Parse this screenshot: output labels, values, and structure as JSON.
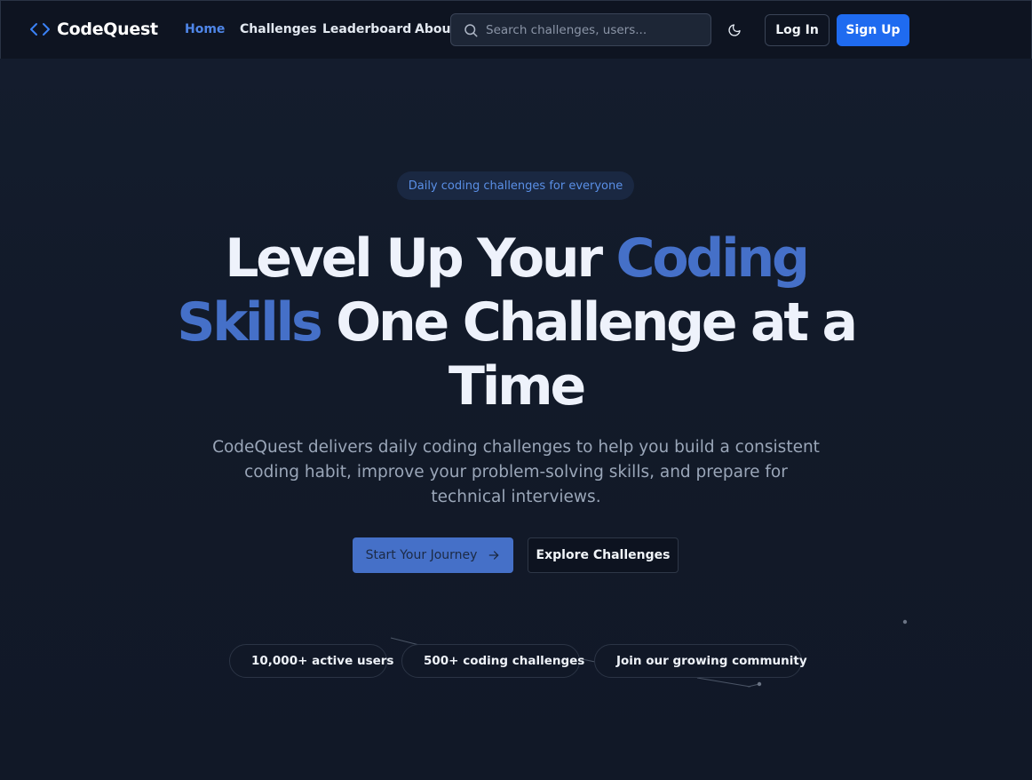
{
  "nav": {
    "brand": "CodeQuest",
    "links": [
      {
        "label": "Home",
        "active": true
      },
      {
        "label": "Challenges",
        "active": false
      },
      {
        "label": "Leaderboard",
        "active": false
      },
      {
        "label": "About",
        "active": false
      }
    ],
    "search_placeholder": "Search challenges, users...",
    "theme_icon": "moon-icon",
    "login_label": "Log In",
    "signup_label": "Sign Up"
  },
  "hero": {
    "tagline": "Daily coding challenges for everyone",
    "headline_part1": "Level Up Your ",
    "headline_accent1": "Coding",
    "headline_accent2": "Skills",
    "headline_part2": " One Challenge at a",
    "headline_part3": "Time",
    "subtitle": "CodeQuest delivers daily coding challenges to help you build a consistent coding habit, improve your problem-solving skills, and prepare for technical interviews.",
    "primary_cta": "Start Your Journey",
    "secondary_cta": "Explore Challenges"
  },
  "stats": [
    {
      "label": "10,000+ active users",
      "dot_color": "#16a34a"
    },
    {
      "label": "500+ coding challenges",
      "dot_color": "#2563eb"
    },
    {
      "label": "Join our growing community",
      "dot_color": "#7e3fd0"
    }
  ],
  "colors": {
    "accent": "#4570c8",
    "primary_button": "#1f6bf0",
    "background": "#111827"
  }
}
